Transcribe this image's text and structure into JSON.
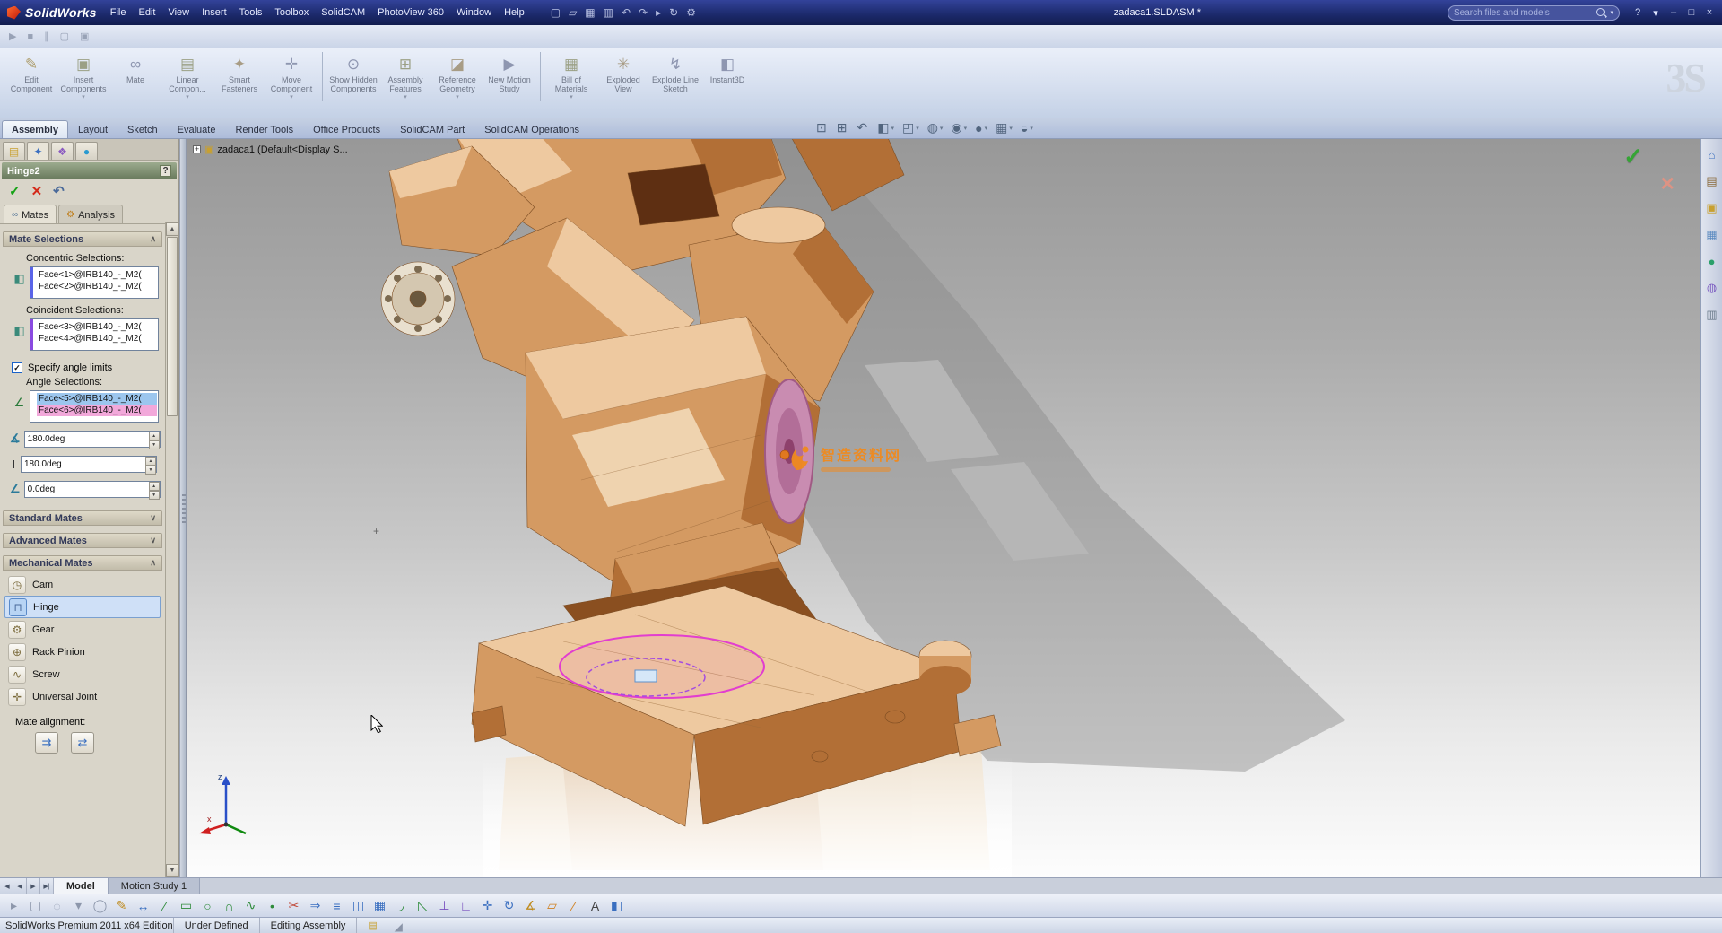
{
  "colors": {
    "titlebar-top": "#33439a",
    "titlebar-bottom": "#121c4e",
    "accent-blue": "#3a6fc0",
    "panel-bg": "#d9d5c9",
    "pm-header-start": "#9cab8e",
    "pm-header-end": "#68795c",
    "group-header-start": "#ded9c8",
    "group-header-end": "#c2bcaa",
    "selection-blue": "#9cc6ee",
    "selection-pink": "#f2a8da",
    "robot-light": "#eec9a0",
    "robot-mid": "#d49a62",
    "robot-dark": "#b26f36",
    "robot-deep": "#8a4f20",
    "robot-cream": "#f3ddbd",
    "disc-pink": "#c98cb1",
    "disc-pink-dark": "#a05a84",
    "highlight-magenta": "#e23ecf",
    "highlight-purple": "#a44ce0",
    "shadow-gray": "#8a8a8a",
    "watermark-orange": "#f08a1e",
    "ok-green": "#17a317",
    "cancel-red": "#d42a1a"
  },
  "glyphs": {
    "spin_up": "▲",
    "spin_down": "▼",
    "dropdown": "▾",
    "expand_plus": "+",
    "cross": "+",
    "scroll_up": "▲",
    "scroll_down": "▼"
  },
  "titlebar": {
    "logo": "SolidWorks",
    "menus": [
      {
        "label": "File",
        "name": "menu-file"
      },
      {
        "label": "Edit",
        "name": "menu-edit"
      },
      {
        "label": "View",
        "name": "menu-view"
      },
      {
        "label": "Insert",
        "name": "menu-insert"
      },
      {
        "label": "Tools",
        "name": "menu-tools"
      },
      {
        "label": "Toolbox",
        "name": "menu-toolbox"
      },
      {
        "label": "SolidCAM",
        "name": "menu-solidcam"
      },
      {
        "label": "PhotoView 360",
        "name": "menu-photoview-360"
      },
      {
        "label": "Window",
        "name": "menu-window"
      },
      {
        "label": "Help",
        "name": "menu-help"
      }
    ],
    "quick_icons": [
      {
        "name": "new-file-icon",
        "glyph": "▢"
      },
      {
        "name": "open-icon",
        "glyph": "▱"
      },
      {
        "name": "save-icon",
        "glyph": "▦"
      },
      {
        "name": "print-icon",
        "glyph": "▥"
      },
      {
        "name": "undo-icon",
        "glyph": "↶"
      },
      {
        "name": "redo-icon",
        "glyph": "↷"
      },
      {
        "name": "select-arrow-icon",
        "glyph": "▸"
      },
      {
        "name": "rebuild-icon",
        "glyph": "↻"
      },
      {
        "name": "options-icon",
        "glyph": "⚙"
      }
    ],
    "doc_title": "zadaca1.SLDASM *",
    "search_placeholder": "Search files and models",
    "search_dropdown": "▾",
    "window_controls": [
      {
        "name": "help-icon",
        "glyph": "?"
      },
      {
        "name": "help-dropdown-icon",
        "glyph": "▾"
      },
      {
        "name": "minimize-icon",
        "glyph": "–"
      },
      {
        "name": "maximize-icon",
        "glyph": "□"
      },
      {
        "name": "close-icon",
        "glyph": "×"
      }
    ]
  },
  "macro_icons": [
    {
      "name": "run-macro-icon",
      "glyph": "▶"
    },
    {
      "name": "stop-macro-icon",
      "glyph": "■"
    },
    {
      "name": "pause-macro-icon",
      "glyph": "∥"
    },
    {
      "name": "new-macro-icon",
      "glyph": "▢"
    },
    {
      "name": "capture-icon",
      "glyph": "▣"
    }
  ],
  "ribbon": {
    "ds_logo": "3S",
    "buttons": [
      {
        "name": "edit-component-button",
        "label": "Edit Component",
        "glyph": "✎",
        "color": "#a08a4a",
        "dd": "",
        "sep": ""
      },
      {
        "name": "insert-components-button",
        "label": "Insert Components",
        "glyph": "▣",
        "color": "#8a8f6a",
        "dd": "▾",
        "sep": ""
      },
      {
        "name": "mate-button",
        "label": "Mate",
        "glyph": "∞",
        "color": "#7a82a0",
        "dd": "",
        "sep": ""
      },
      {
        "name": "linear-component-pattern-button",
        "label": "Linear Compon...",
        "glyph": "▤",
        "color": "#8a8f6a",
        "dd": "▾",
        "sep": ""
      },
      {
        "name": "smart-fasteners-button",
        "label": "Smart Fasteners",
        "glyph": "✦",
        "color": "#9a8a6a",
        "dd": "",
        "sep": ""
      },
      {
        "name": "move-component-button",
        "label": "Move Component",
        "glyph": "✛",
        "color": "#7a82a0",
        "dd": "▾",
        "sep": "rsep-after"
      },
      {
        "name": "show-hidden-components-button",
        "label": "Show Hidden Components",
        "glyph": "⊙",
        "color": "#7a82a0",
        "dd": "",
        "sep": ""
      },
      {
        "name": "assembly-features-button",
        "label": "Assembly Features",
        "glyph": "⊞",
        "color": "#8a8f6a",
        "dd": "▾",
        "sep": ""
      },
      {
        "name": "reference-geometry-button",
        "label": "Reference Geometry",
        "glyph": "◪",
        "color": "#9a8a6a",
        "dd": "▾",
        "sep": ""
      },
      {
        "name": "new-motion-study-button",
        "label": "New Motion Study",
        "glyph": "▶",
        "color": "#7a82a0",
        "dd": "",
        "sep": "rsep-after"
      },
      {
        "name": "bill-of-materials-button",
        "label": "Bill of Materials",
        "glyph": "▦",
        "color": "#8a8f6a",
        "dd": "▾",
        "sep": ""
      },
      {
        "name": "exploded-view-button",
        "label": "Exploded View",
        "glyph": "✳",
        "color": "#9a8a6a",
        "dd": "",
        "sep": ""
      },
      {
        "name": "explode-line-sketch-button",
        "label": "Explode Line Sketch",
        "glyph": "↯",
        "color": "#7a82a0",
        "dd": "",
        "sep": ""
      },
      {
        "name": "instant3d-button",
        "label": "Instant3D",
        "glyph": "◧",
        "color": "#7a82a0",
        "dd": "",
        "sep": ""
      }
    ]
  },
  "command_tabs": [
    {
      "label": "Assembly",
      "name": "tab-assembly",
      "state": "active"
    },
    {
      "label": "Layout",
      "name": "tab-layout",
      "state": ""
    },
    {
      "label": "Sketch",
      "name": "tab-sketch",
      "state": ""
    },
    {
      "label": "Evaluate",
      "name": "tab-evaluate",
      "state": ""
    },
    {
      "label": "Render Tools",
      "name": "tab-render-tools",
      "state": ""
    },
    {
      "label": "Office Products",
      "name": "tab-office-products",
      "state": ""
    },
    {
      "label": "SolidCAM Part",
      "name": "tab-solidcam-part",
      "state": ""
    },
    {
      "label": "SolidCAM Operations",
      "name": "tab-solidcam-operations",
      "state": ""
    }
  ],
  "hud_icons": [
    {
      "name": "zoom-fit-icon",
      "glyph": "⊡",
      "dd": ""
    },
    {
      "name": "zoom-area-icon",
      "glyph": "⊞",
      "dd": ""
    },
    {
      "name": "previous-view-icon",
      "glyph": "↶",
      "dd": ""
    },
    {
      "name": "section-view-icon",
      "glyph": "◧",
      "dd": "▾"
    },
    {
      "name": "view-orientation-icon",
      "glyph": "◰",
      "dd": "▾"
    },
    {
      "name": "display-style-icon",
      "glyph": "◍",
      "dd": "▾"
    },
    {
      "name": "hide-show-items-icon",
      "glyph": "◉",
      "dd": "▾"
    },
    {
      "name": "edit-appearance-icon",
      "glyph": "●",
      "dd": "▾"
    },
    {
      "name": "apply-scene-icon",
      "glyph": "▦",
      "dd": "▾"
    },
    {
      "name": "view-settings-icon",
      "glyph": "◒",
      "dd": "▾"
    }
  ],
  "property_manager": {
    "tabs_icons": [
      {
        "name": "featuremanager-tab-icon",
        "glyph": "▤",
        "color": "#c8a030",
        "state": ""
      },
      {
        "name": "propertymanager-tab-icon",
        "glyph": "✦",
        "color": "#3a6fc0",
        "state": "active"
      },
      {
        "name": "configurationmanager-tab-icon",
        "glyph": "❖",
        "color": "#8a5ac0",
        "state": ""
      },
      {
        "name": "displaymanager-tab-icon",
        "glyph": "●",
        "color": "#2a9ad0",
        "state": ""
      }
    ],
    "title": "Hinge2",
    "help_glyph": "?",
    "actions": [
      {
        "name": "ok-button",
        "glyph": "✓",
        "color": "#17a317"
      },
      {
        "name": "cancel-button",
        "glyph": "✕",
        "color": "#d42a1a"
      },
      {
        "name": "undo-button",
        "glyph": "↶",
        "color": "#4a6a9a"
      }
    ],
    "view_tabs": [
      {
        "label": "Mates",
        "icon_name": "mates-tab-icon",
        "icon_glyph": "∞",
        "icon_color": "#5a7a9a",
        "state": "active"
      },
      {
        "label": "Analysis",
        "icon_name": "analysis-tab-icon",
        "icon_glyph": "⚙",
        "icon_color": "#c08020",
        "state": ""
      }
    ],
    "mate_selections": {
      "header": "Mate Selections",
      "chevron": "∧",
      "concentric_label": "Concentric Selections:",
      "concentric_icon": {
        "glyph": "◧",
        "color": "#3a8a7a"
      },
      "concentric_strip": "#5a64e8",
      "concentric_items": [
        {
          "text": "Face<1>@IRB140_-_M2("
        },
        {
          "text": "Face<2>@IRB140_-_M2("
        }
      ],
      "coincident_label": "Coincident Selections:",
      "coincident_icon": {
        "glyph": "◧",
        "color": "#3a8a7a"
      },
      "coincident_strip": "#8a4ae0",
      "coincident_items": [
        {
          "text": "Face<3>@IRB140_-_M2("
        },
        {
          "text": "Face<4>@IRB140_-_M2("
        }
      ],
      "specify_label": "Specify angle limits",
      "check_glyph": "✓",
      "angle_label": "Angle Selections:",
      "angle_icon": {
        "glyph": "∠",
        "color": "#2a7a3a"
      },
      "angle_items": [
        {
          "text": "Face<5>@IRB140_-_M2(",
          "bg": "#9cc6ee"
        },
        {
          "text": "Face<6>@IRB140_-_M2(",
          "bg": "#f2a8da"
        }
      ],
      "angle_fields": [
        {
          "name": "angle-value-field",
          "icon_name": "angle-icon",
          "icon": "∡",
          "icon_color": "#2a7a9a",
          "value": "180.0deg"
        },
        {
          "name": "max-angle-field",
          "icon_name": "max-angle-icon",
          "icon": "I",
          "icon_color": "#333333",
          "value": "180.0deg"
        },
        {
          "name": "min-angle-field",
          "icon_name": "min-angle-icon",
          "icon": "∠",
          "icon_color": "#2a7a9a",
          "value": "0.0deg"
        }
      ]
    },
    "standard_header": {
      "label": "Standard Mates",
      "chevron": "∨"
    },
    "advanced_header": {
      "label": "Advanced Mates",
      "chevron": "∨"
    },
    "mechanical_header": {
      "label": "Mechanical Mates",
      "chevron": "∧"
    },
    "mechanical_mates": [
      {
        "label": "Cam",
        "name": "mate-type-cam",
        "glyph": "◷",
        "color": "#7a6a3a",
        "state": ""
      },
      {
        "label": "Hinge",
        "name": "mate-type-hinge",
        "glyph": "⊓",
        "color": "#4a6a9a",
        "state": "selected"
      },
      {
        "label": "Gear",
        "name": "mate-type-gear",
        "glyph": "⚙",
        "color": "#7a6a3a",
        "state": ""
      },
      {
        "label": "Rack Pinion",
        "name": "mate-type-rack-pinion",
        "glyph": "⊕",
        "color": "#7a6a3a",
        "state": ""
      },
      {
        "label": "Screw",
        "name": "mate-type-screw",
        "glyph": "∿",
        "color": "#7a6a3a",
        "state": ""
      },
      {
        "label": "Universal Joint",
        "name": "mate-type-universal-joint",
        "glyph": "✛",
        "color": "#7a6a3a",
        "state": ""
      }
    ],
    "alignment_label": "Mate alignment:",
    "alignment_buttons": [
      {
        "name": "aligned-button",
        "glyph": "⇉",
        "color": "#3a6fc0"
      },
      {
        "name": "anti-aligned-button",
        "glyph": "⇄",
        "color": "#3a6fc0"
      }
    ]
  },
  "viewport": {
    "tree_label": "zadaca1  (Default<Display S...",
    "confirm_ok": "✓",
    "confirm_cancel": "✕",
    "watermark": "智造资料网",
    "triad_x": "x",
    "triad_z": "z"
  },
  "taskpane_icons": [
    {
      "name": "solidworks-resources-icon",
      "glyph": "⌂",
      "color": "#3a6fc0"
    },
    {
      "name": "design-library-icon",
      "glyph": "▤",
      "color": "#8a6a3a"
    },
    {
      "name": "file-explorer-icon",
      "glyph": "▣",
      "color": "#c8a030"
    },
    {
      "name": "view-palette-icon",
      "glyph": "▦",
      "color": "#5a8ac0"
    },
    {
      "name": "appearances-scenes-icon",
      "glyph": "●",
      "color": "#2aa06a"
    },
    {
      "name": "decals-icon",
      "glyph": "◍",
      "color": "#7a5ac0"
    },
    {
      "name": "custom-properties-icon",
      "glyph": "▥",
      "color": "#6a7a8a"
    }
  ],
  "doc_tabs": {
    "nav": [
      {
        "name": "first-tab-icon",
        "glyph": "|◀"
      },
      {
        "name": "prev-tab-icon",
        "glyph": "◀"
      },
      {
        "name": "next-tab-icon",
        "glyph": "▶"
      },
      {
        "name": "last-tab-icon",
        "glyph": "▶|"
      }
    ],
    "tabs": [
      {
        "label": "Model",
        "name": "tab-model",
        "state": "active"
      },
      {
        "label": "Motion Study 1",
        "name": "tab-motion-study-1",
        "state": ""
      }
    ]
  },
  "bottom_tools": [
    {
      "name": "select-cursor-icon",
      "glyph": "▸",
      "color": "#8d97ab"
    },
    {
      "name": "box-select-icon",
      "glyph": "▢",
      "color": "#8d97ab"
    },
    {
      "name": "lasso-select-icon",
      "glyph": "◌",
      "color": "#8d97ab"
    },
    {
      "name": "select-filter-icon",
      "glyph": "▾",
      "color": "#8d97ab"
    },
    {
      "name": "zoom-cursor-icon",
      "glyph": "◯",
      "color": "#8d97ab"
    },
    {
      "name": "sketch-icon",
      "glyph": "✎",
      "color": "#bf8b1f"
    },
    {
      "name": "smart-dimension-icon",
      "glyph": "↔",
      "color": "#3a6fc0"
    },
    {
      "name": "line-icon",
      "glyph": "∕",
      "color": "#2e8b3a"
    },
    {
      "name": "rectangle-icon",
      "glyph": "▭",
      "color": "#2e8b3a"
    },
    {
      "name": "circle-icon",
      "glyph": "○",
      "color": "#2e8b3a"
    },
    {
      "name": "arc-icon",
      "glyph": "∩",
      "color": "#2e8b3a"
    },
    {
      "name": "spline-icon",
      "glyph": "∿",
      "color": "#2e8b3a"
    },
    {
      "name": "point-icon",
      "glyph": "•",
      "color": "#2e8b3a"
    },
    {
      "name": "trim-icon",
      "glyph": "✂",
      "color": "#c04a3a"
    },
    {
      "name": "convert-entities-icon",
      "glyph": "⇒",
      "color": "#3a6fc0"
    },
    {
      "name": "offset-entities-icon",
      "glyph": "≡",
      "color": "#3a6fc0"
    },
    {
      "name": "mirror-entities-icon",
      "glyph": "◫",
      "color": "#3a6fc0"
    },
    {
      "name": "linear-pattern-icon",
      "glyph": "▦",
      "color": "#3a6fc0"
    },
    {
      "name": "fillet-icon",
      "glyph": "◞",
      "color": "#2e8b3a"
    },
    {
      "name": "chamfer-icon",
      "glyph": "◺",
      "color": "#2e8b3a"
    },
    {
      "name": "add-relation-icon",
      "glyph": "⊥",
      "color": "#7a52c0"
    },
    {
      "name": "display-relations-icon",
      "glyph": "∟",
      "color": "#7a52c0"
    },
    {
      "name": "move-entities-icon",
      "glyph": "✛",
      "color": "#3a6fc0"
    },
    {
      "name": "rotate-entities-icon",
      "glyph": "↻",
      "color": "#3a6fc0"
    },
    {
      "name": "measure-icon",
      "glyph": "∡",
      "color": "#bf8b1f"
    },
    {
      "name": "plane-icon",
      "glyph": "▱",
      "color": "#d08020"
    },
    {
      "name": "axis-icon",
      "glyph": "⁄",
      "color": "#d08020"
    },
    {
      "name": "text-icon",
      "glyph": "A",
      "color": "#444444"
    },
    {
      "name": "section-icon",
      "glyph": "◧",
      "color": "#3a6fc0"
    }
  ],
  "status_bar": {
    "left": "SolidWorks Premium 2011 x64 Edition",
    "fields": [
      {
        "label": "Under Defined",
        "name": "definition-status"
      },
      {
        "label": "Editing Assembly",
        "name": "editing-mode-status"
      }
    ],
    "icon_glyph": "▤",
    "grip_glyph": "◢"
  }
}
